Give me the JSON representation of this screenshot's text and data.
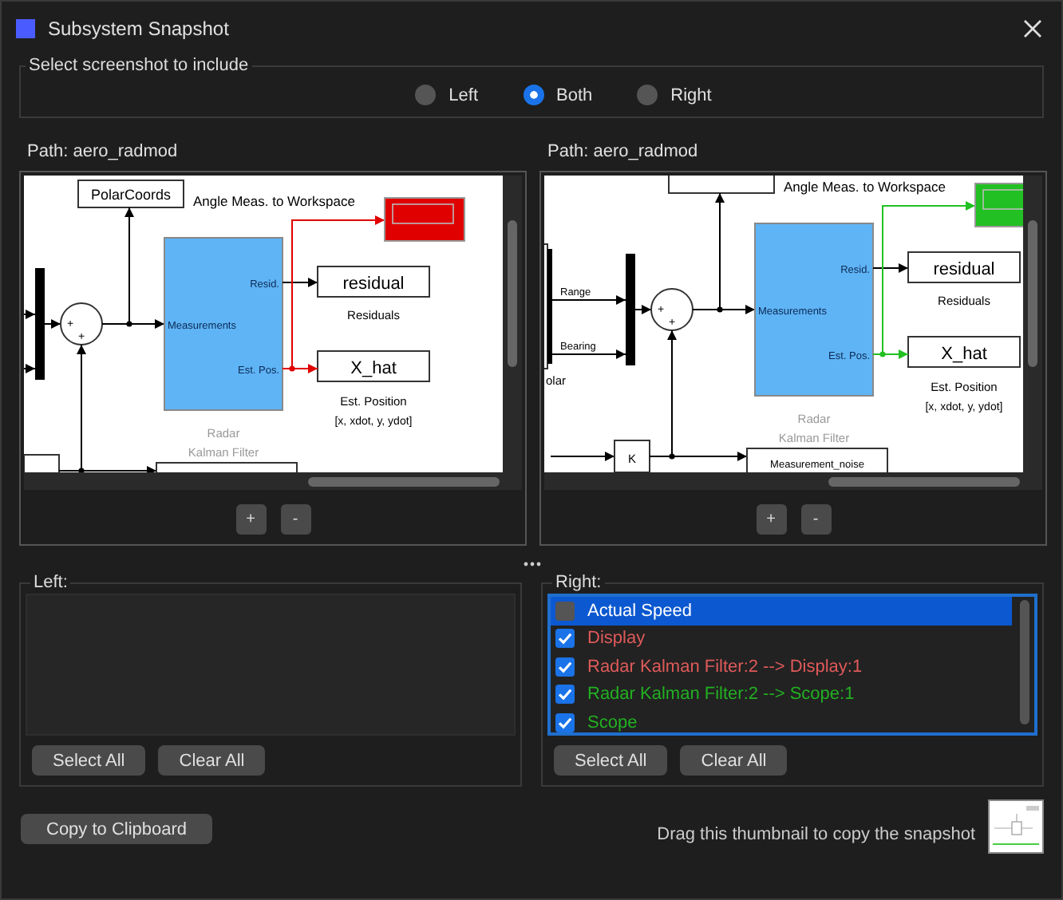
{
  "window": {
    "title": "Subsystem Snapshot"
  },
  "screenshot_selector": {
    "legend": "Select screenshot to include",
    "options": [
      {
        "label": "Left",
        "selected": false
      },
      {
        "label": "Both",
        "selected": true
      },
      {
        "label": "Right",
        "selected": false
      }
    ]
  },
  "panes": [
    {
      "path": "Path: aero_radmod",
      "color": "#e00000",
      "zoom_buttons": [
        "+",
        "-"
      ],
      "labels": [
        {
          "kind": "polar-block",
          "text": "PolarCoords"
        },
        {
          "kind": "angle-caption",
          "text": "Angle Meas. to Workspace"
        },
        {
          "kind": "sum-sign-left",
          "text": "+"
        },
        {
          "kind": "sum-sign-bottom",
          "text": "+"
        },
        {
          "kind": "resid-port",
          "text": "Resid."
        },
        {
          "kind": "meas-port",
          "text": "Measurements"
        },
        {
          "kind": "estpos-port",
          "text": "Est. Pos."
        },
        {
          "kind": "residual-block",
          "text": "residual"
        },
        {
          "kind": "residuals-caption",
          "text": "Residuals"
        },
        {
          "kind": "xhat-block",
          "text": "X_hat"
        },
        {
          "kind": "estposition-caption",
          "text": "Est. Position"
        },
        {
          "kind": "state-caption",
          "text": "[x, xdot, y, ydot]"
        },
        {
          "kind": "radar-caption",
          "text": "Radar"
        },
        {
          "kind": "kalman-caption",
          "text": "Kalman Filter"
        }
      ]
    },
    {
      "path": "Path: aero_radmod",
      "color": "#22c022",
      "zoom_buttons": [
        "+",
        "-"
      ],
      "labels": [
        {
          "kind": "angle-caption",
          "text": "Angle Meas. to Workspace"
        },
        {
          "kind": "range-port",
          "text": "Range"
        },
        {
          "kind": "bearing-port",
          "text": "Bearing"
        },
        {
          "kind": "polar-caption",
          "text": "olar"
        },
        {
          "kind": "sum-sign-left",
          "text": "+"
        },
        {
          "kind": "sum-sign-bottom",
          "text": "+"
        },
        {
          "kind": "resid-port",
          "text": "Resid."
        },
        {
          "kind": "meas-port",
          "text": "Measurements"
        },
        {
          "kind": "estpos-port",
          "text": "Est. Pos."
        },
        {
          "kind": "residual-block",
          "text": "residual"
        },
        {
          "kind": "residuals-caption",
          "text": "Residuals"
        },
        {
          "kind": "xhat-block",
          "text": "X_hat"
        },
        {
          "kind": "estposition-caption",
          "text": "Est. Position"
        },
        {
          "kind": "state-caption",
          "text": "[x, xdot, y, ydot]"
        },
        {
          "kind": "radar-caption",
          "text": "Radar"
        },
        {
          "kind": "kalman-caption",
          "text": "Kalman Filter"
        },
        {
          "kind": "gain-block",
          "text": "K"
        },
        {
          "kind": "noise-block",
          "text": "Measurement_noise"
        }
      ]
    }
  ],
  "lists": [
    {
      "legend": "Left:",
      "buttons": [
        "Select All",
        "Clear All"
      ]
    },
    {
      "legend": "Right:",
      "items": [
        {
          "label": "Actual Speed",
          "checked": false,
          "selected": true,
          "color": "#ffffff"
        },
        {
          "label": "Display",
          "checked": true,
          "selected": false,
          "color": "#e05a5a"
        },
        {
          "label": "Radar Kalman Filter:2 --> Display:1",
          "checked": true,
          "selected": false,
          "color": "#e05a5a"
        },
        {
          "label": "Radar Kalman Filter:2 --> Scope:1",
          "checked": true,
          "selected": false,
          "color": "#22b022"
        },
        {
          "label": "Scope",
          "checked": true,
          "selected": false,
          "color": "#22b022"
        }
      ],
      "buttons": [
        "Select All",
        "Clear All"
      ]
    }
  ],
  "footer": {
    "copy_button": "Copy to Clipboard",
    "drag_hint": "Drag this thumbnail to copy the snapshot"
  }
}
